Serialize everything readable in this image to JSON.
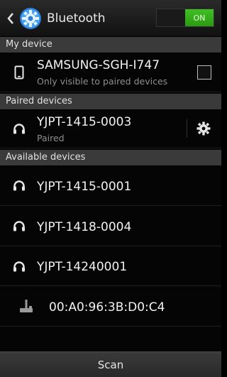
{
  "header": {
    "title": "Bluetooth",
    "toggle_label": "ON",
    "accent": "#3ab01b"
  },
  "my_device": {
    "section_label": "My device",
    "name": "SAMSUNG-SGH-I747",
    "subtitle": "Only visible to paired devices",
    "visible_checked": false,
    "icon": "phone-icon"
  },
  "paired": {
    "section_label": "Paired devices",
    "items": [
      {
        "name": "YJPT-1415-0003",
        "status": "Paired",
        "icon": "headphones-icon"
      }
    ]
  },
  "available": {
    "section_label": "Available devices",
    "items": [
      {
        "name": "YJPT-1415-0001",
        "icon": "headphones-icon"
      },
      {
        "name": "YJPT-1418-0004",
        "icon": "headphones-icon"
      },
      {
        "name": "YJPT-14240001",
        "icon": "headphones-icon"
      },
      {
        "name": "00:A0:96:3B:D0:C4",
        "icon": "joystick-icon"
      }
    ]
  },
  "footer": {
    "scan_label": "Scan"
  }
}
